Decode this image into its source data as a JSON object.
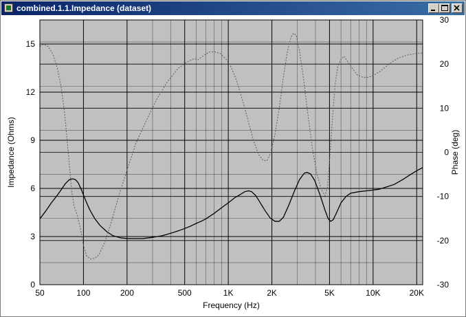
{
  "window": {
    "title": "combined.1.1.Impedance (dataset)",
    "icon": "chart-window-icon",
    "buttons": {
      "minimize": "minimize-icon",
      "maximize": "maximize-icon",
      "close": "close-icon"
    }
  },
  "colors": {
    "title_bar": "#0a246a",
    "plot_background": "#c0c0c0",
    "grid": "#000000",
    "impedance_line": "#000000",
    "phase_line": "#5a5a5a"
  },
  "chart_data": {
    "type": "line",
    "xscale": "log",
    "xlabel": "Frequency (Hz)",
    "ylabel": "Impedance (Ohms)",
    "y2label": "Phase (deg)",
    "xlim": [
      50,
      22000
    ],
    "ylim": [
      0,
      16.5
    ],
    "y2lim": [
      -30,
      30
    ],
    "x_ticks": [
      {
        "value": 50,
        "label": "50"
      },
      {
        "value": 100,
        "label": "100"
      },
      {
        "value": 200,
        "label": "200"
      },
      {
        "value": 500,
        "label": "500"
      },
      {
        "value": 1000,
        "label": "1K"
      },
      {
        "value": 2000,
        "label": "2K"
      },
      {
        "value": 5000,
        "label": "5K"
      },
      {
        "value": 10000,
        "label": "10K"
      },
      {
        "value": 20000,
        "label": "20K"
      }
    ],
    "x_minor_gridlines": [
      300,
      400,
      600,
      700,
      800,
      900,
      3000,
      4000,
      6000,
      7000,
      8000,
      9000
    ],
    "y_ticks": [
      0,
      3,
      6,
      9,
      12,
      15
    ],
    "y2_ticks": [
      -30,
      -20,
      -10,
      0,
      10,
      20,
      30
    ],
    "y2_gridlines": [
      -25,
      -15,
      -5,
      5,
      15,
      25
    ],
    "grid": true,
    "series": [
      {
        "axis": "left",
        "style": "solid",
        "points": [
          [
            50,
            4.1
          ],
          [
            55,
            4.6
          ],
          [
            60,
            5.1
          ],
          [
            65,
            5.5
          ],
          [
            70,
            5.9
          ],
          [
            75,
            6.3
          ],
          [
            80,
            6.55
          ],
          [
            84,
            6.6
          ],
          [
            88,
            6.55
          ],
          [
            92,
            6.35
          ],
          [
            97,
            5.9
          ],
          [
            103,
            5.3
          ],
          [
            110,
            4.7
          ],
          [
            120,
            4.1
          ],
          [
            130,
            3.7
          ],
          [
            145,
            3.3
          ],
          [
            160,
            3.05
          ],
          [
            180,
            2.92
          ],
          [
            200,
            2.88
          ],
          [
            230,
            2.87
          ],
          [
            260,
            2.88
          ],
          [
            300,
            2.95
          ],
          [
            350,
            3.05
          ],
          [
            400,
            3.2
          ],
          [
            450,
            3.35
          ],
          [
            500,
            3.5
          ],
          [
            550,
            3.65
          ],
          [
            600,
            3.82
          ],
          [
            650,
            3.95
          ],
          [
            700,
            4.1
          ],
          [
            800,
            4.45
          ],
          [
            900,
            4.8
          ],
          [
            1000,
            5.1
          ],
          [
            1100,
            5.4
          ],
          [
            1200,
            5.6
          ],
          [
            1300,
            5.8
          ],
          [
            1380,
            5.85
          ],
          [
            1450,
            5.8
          ],
          [
            1550,
            5.55
          ],
          [
            1650,
            5.15
          ],
          [
            1800,
            4.6
          ],
          [
            1950,
            4.15
          ],
          [
            2100,
            3.95
          ],
          [
            2250,
            3.95
          ],
          [
            2400,
            4.2
          ],
          [
            2600,
            4.9
          ],
          [
            2850,
            5.8
          ],
          [
            3100,
            6.55
          ],
          [
            3350,
            6.95
          ],
          [
            3500,
            7.0
          ],
          [
            3700,
            6.9
          ],
          [
            3950,
            6.5
          ],
          [
            4300,
            5.6
          ],
          [
            4650,
            4.65
          ],
          [
            4900,
            4.1
          ],
          [
            5100,
            3.95
          ],
          [
            5300,
            4.05
          ],
          [
            5600,
            4.5
          ],
          [
            6000,
            5.1
          ],
          [
            6500,
            5.5
          ],
          [
            7000,
            5.7
          ],
          [
            8000,
            5.8
          ],
          [
            9000,
            5.85
          ],
          [
            10000,
            5.9
          ],
          [
            11000,
            5.95
          ],
          [
            12000,
            6.05
          ],
          [
            14000,
            6.25
          ],
          [
            16000,
            6.55
          ],
          [
            18000,
            6.85
          ],
          [
            20000,
            7.1
          ],
          [
            22000,
            7.3
          ]
        ]
      },
      {
        "axis": "right",
        "style": "dashed",
        "points": [
          [
            50,
            24
          ],
          [
            53,
            24.5
          ],
          [
            57,
            24
          ],
          [
            62,
            22
          ],
          [
            66,
            19
          ],
          [
            70,
            15
          ],
          [
            74,
            9
          ],
          [
            77,
            3
          ],
          [
            80,
            -3
          ],
          [
            83,
            -9
          ],
          [
            86,
            -12
          ],
          [
            90,
            -14
          ],
          [
            95,
            -17
          ],
          [
            100,
            -21
          ],
          [
            105,
            -23.5
          ],
          [
            112,
            -24.2
          ],
          [
            120,
            -24
          ],
          [
            128,
            -23.2
          ],
          [
            140,
            -20.5
          ],
          [
            155,
            -16
          ],
          [
            175,
            -10
          ],
          [
            200,
            -4
          ],
          [
            230,
            2
          ],
          [
            270,
            7
          ],
          [
            320,
            12
          ],
          [
            380,
            16
          ],
          [
            450,
            19
          ],
          [
            520,
            20.5
          ],
          [
            580,
            21.2
          ],
          [
            620,
            21
          ],
          [
            680,
            22
          ],
          [
            740,
            22.7
          ],
          [
            800,
            22.8
          ],
          [
            880,
            22.4
          ],
          [
            960,
            21.2
          ],
          [
            1040,
            19.5
          ],
          [
            1120,
            17
          ],
          [
            1200,
            14
          ],
          [
            1300,
            10
          ],
          [
            1400,
            6
          ],
          [
            1500,
            2.5
          ],
          [
            1620,
            -0.5
          ],
          [
            1740,
            -1.8
          ],
          [
            1850,
            -1.9
          ],
          [
            1970,
            0
          ],
          [
            2100,
            4
          ],
          [
            2250,
            10
          ],
          [
            2400,
            17
          ],
          [
            2550,
            22.5
          ],
          [
            2700,
            26
          ],
          [
            2820,
            27
          ],
          [
            2950,
            26.5
          ],
          [
            3100,
            23
          ],
          [
            3300,
            17
          ],
          [
            3500,
            10
          ],
          [
            3800,
            1
          ],
          [
            4100,
            -5
          ],
          [
            4400,
            -8.5
          ],
          [
            4650,
            -9.8
          ],
          [
            4850,
            -8
          ],
          [
            5050,
            0
          ],
          [
            5250,
            8
          ],
          [
            5450,
            15
          ],
          [
            5700,
            19.5
          ],
          [
            6000,
            21
          ],
          [
            6300,
            21.8
          ],
          [
            6700,
            20.5
          ],
          [
            7200,
            19
          ],
          [
            7800,
            17.5
          ],
          [
            8500,
            17
          ],
          [
            9300,
            17
          ],
          [
            10000,
            17.4
          ],
          [
            11000,
            18.2
          ],
          [
            12000,
            19.2
          ],
          [
            13500,
            20.5
          ],
          [
            15000,
            21.4
          ],
          [
            17000,
            22
          ],
          [
            19000,
            22.3
          ],
          [
            21000,
            22.5
          ],
          [
            22000,
            22.5
          ]
        ]
      }
    ]
  }
}
